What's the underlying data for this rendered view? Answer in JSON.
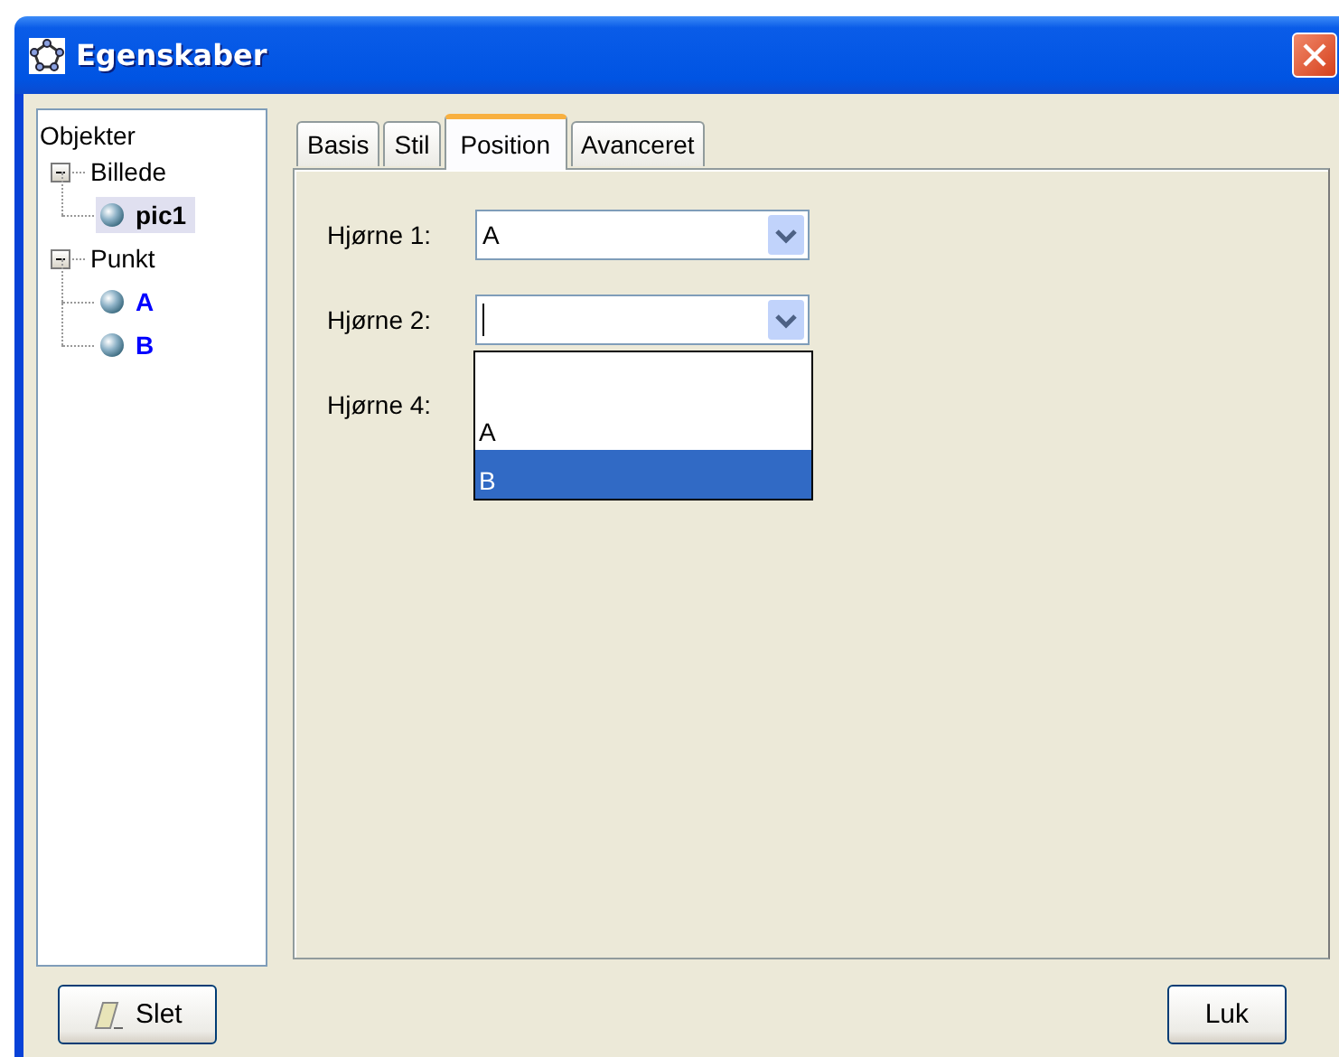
{
  "window": {
    "title": "Egenskaber"
  },
  "tree": {
    "root": "Objekter",
    "children": [
      {
        "label": "Billede",
        "expanded": true,
        "children": [
          {
            "label": "pic1",
            "selected": true,
            "color": "#000000"
          }
        ]
      },
      {
        "label": "Punkt",
        "expanded": true,
        "children": [
          {
            "label": "A",
            "selected": false,
            "color": "#0000ff"
          },
          {
            "label": "B",
            "selected": false,
            "color": "#0000ff"
          }
        ]
      }
    ]
  },
  "tabs": [
    {
      "label": "Basis",
      "selected": false
    },
    {
      "label": "Stil",
      "selected": false
    },
    {
      "label": "Position",
      "selected": true
    },
    {
      "label": "Avanceret",
      "selected": false
    }
  ],
  "fields": [
    {
      "label": "Hjørne 1:",
      "value": "A"
    },
    {
      "label": "Hjørne 2:",
      "focused": true,
      "open": true,
      "options": [
        {
          "kind": "blank"
        },
        {
          "kind": "item",
          "label": "A",
          "selected": false
        },
        {
          "kind": "item",
          "label": "B",
          "selected": true
        }
      ]
    },
    {
      "label": "Hjørne 4:",
      "covered": true
    }
  ],
  "buttons": [
    {
      "kind": "delete",
      "label": "Slet"
    },
    {
      "kind": "close",
      "label": "Luk"
    }
  ]
}
